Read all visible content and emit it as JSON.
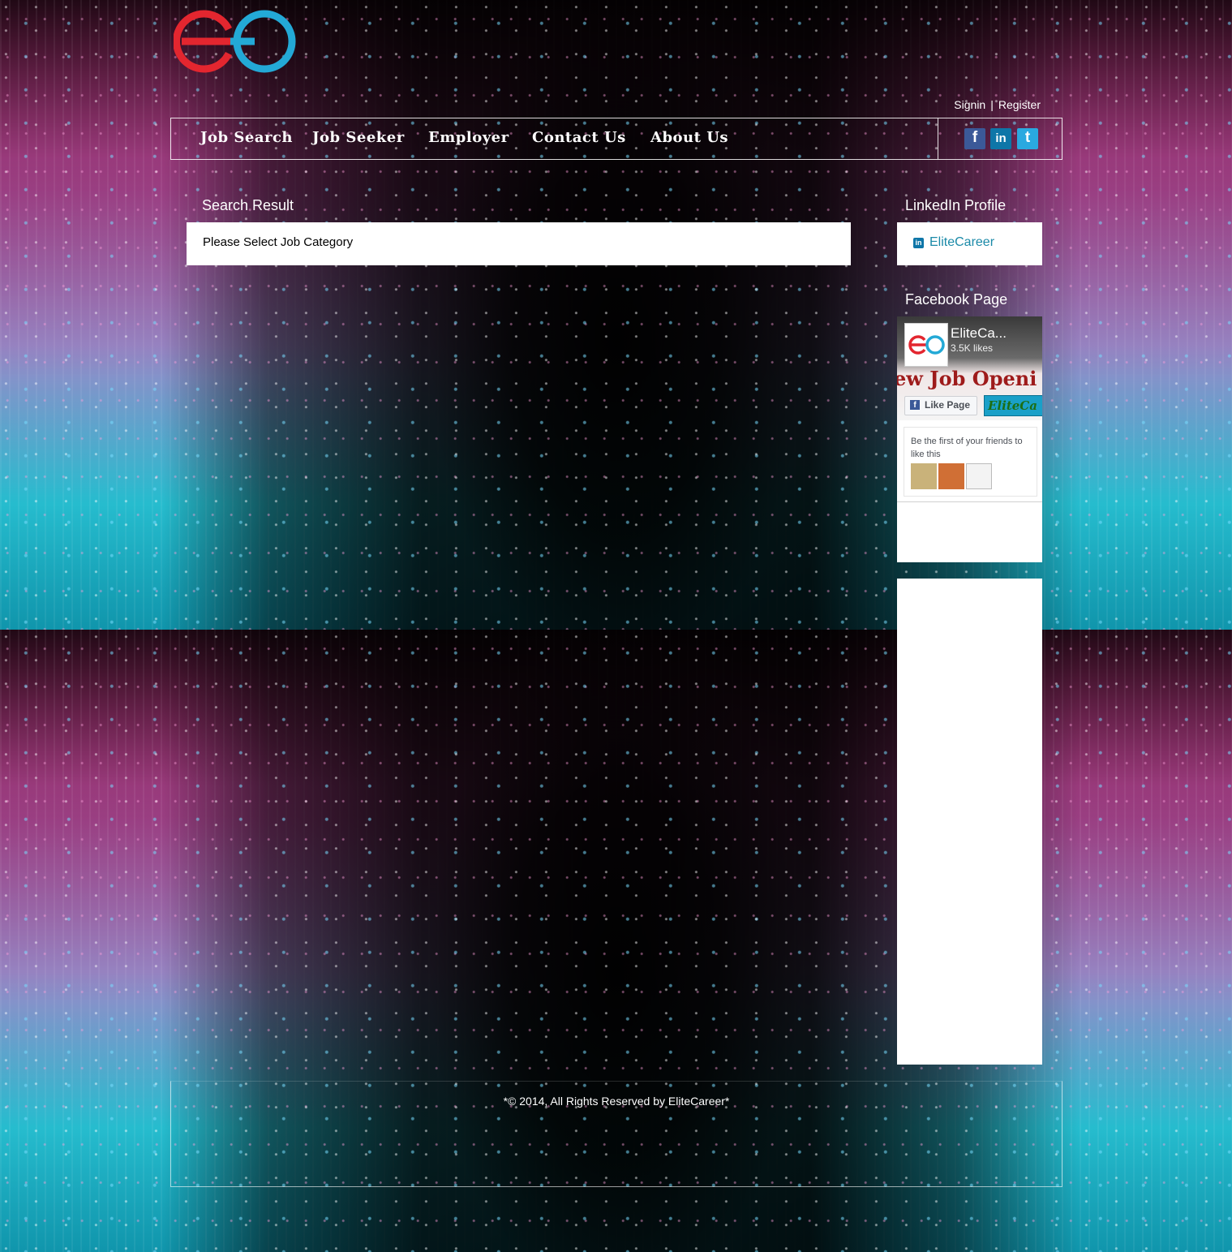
{
  "header": {
    "signin_label": "Signin",
    "separator": "|",
    "register_label": "Register"
  },
  "nav": {
    "items": [
      {
        "label": "Job Search"
      },
      {
        "label": "Job Seeker"
      },
      {
        "label": "Employer"
      },
      {
        "label": "Contact Us"
      },
      {
        "label": "About Us"
      }
    ],
    "social": [
      {
        "name": "facebook-icon",
        "glyph": "f",
        "color": "#3b5998"
      },
      {
        "name": "linkedin-icon",
        "glyph": "in",
        "color": "#0e76a8"
      },
      {
        "name": "twitter-icon",
        "glyph": "t",
        "color": "#2aa9e0"
      }
    ]
  },
  "main": {
    "title": "Search Result",
    "message": "Please Select Job Category"
  },
  "sidebar": {
    "linkedin_title": "LinkedIn Profile",
    "linkedin_link": "EliteCareer",
    "facebook_title": "Facebook Page",
    "facebook_widget": {
      "page_name": "EliteCa...",
      "likes": "3.5K likes",
      "cover_text": "ew Job Openi",
      "like_button": "Like Page",
      "tag_text": "EliteCa",
      "friends_text": "Be the first of your friends to like this"
    }
  },
  "footer": {
    "copyright": "*© 2014, All Rights Reserved by EliteCareer*"
  },
  "colors": {
    "logo_red": "#e3262f",
    "logo_blue": "#23a9d6",
    "link_teal": "#1b8aa8"
  }
}
